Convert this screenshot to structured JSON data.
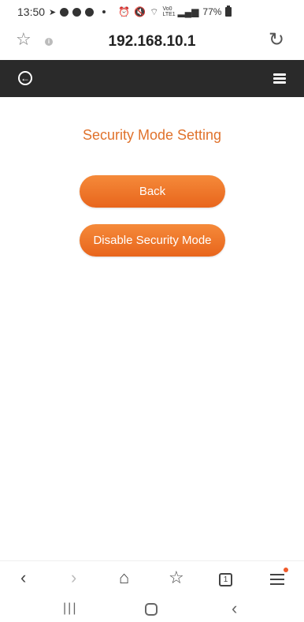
{
  "status_bar": {
    "time": "13:50",
    "battery_text": "77%",
    "network_label": "Vo0 LTE1"
  },
  "browser": {
    "url": "192.168.10.1",
    "tab_count": "1"
  },
  "page": {
    "title": "Security Mode Setting",
    "back_button_label": "Back",
    "disable_button_label": "Disable Security Mode"
  },
  "colors": {
    "accent": "#e0722c",
    "button_top": "#f58a3a",
    "button_bottom": "#e8651c",
    "header_bg": "#2a2a2a"
  }
}
